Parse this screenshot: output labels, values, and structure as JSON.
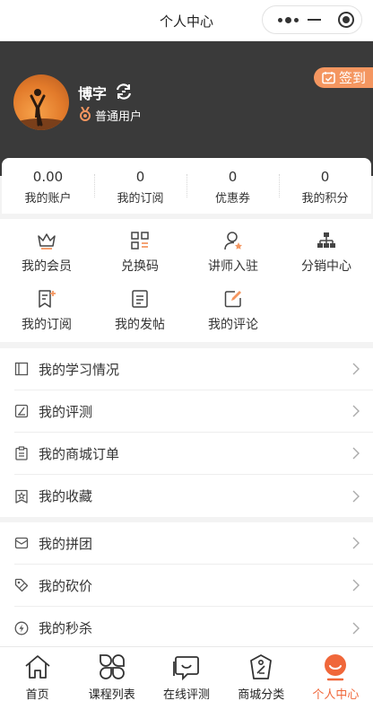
{
  "nav": {
    "title": "个人中心"
  },
  "profile": {
    "name": "博字",
    "user_type": "普通用户",
    "sign_in": "签到"
  },
  "stats": [
    {
      "value": "0.00",
      "label": "我的账户"
    },
    {
      "value": "0",
      "label": "我的订阅"
    },
    {
      "value": "0",
      "label": "优惠券"
    },
    {
      "value": "0",
      "label": "我的积分"
    }
  ],
  "grid": [
    {
      "label": "我的会员",
      "icon": "crown-icon"
    },
    {
      "label": "兑换码",
      "icon": "grid-code-icon"
    },
    {
      "label": "讲师入驻",
      "icon": "lecturer-icon"
    },
    {
      "label": "分销中心",
      "icon": "org-chart-icon"
    },
    {
      "label": "我的订阅",
      "icon": "bookmark-note-icon"
    },
    {
      "label": "我的发帖",
      "icon": "post-doc-icon"
    },
    {
      "label": "我的评论",
      "icon": "edit-icon"
    }
  ],
  "list1": [
    {
      "label": "我的学习情况",
      "icon": "book-icon"
    },
    {
      "label": "我的评测",
      "icon": "quiz-icon"
    },
    {
      "label": "我的商城订单",
      "icon": "order-list-icon"
    },
    {
      "label": "我的收藏",
      "icon": "star-icon"
    }
  ],
  "list2": [
    {
      "label": "我的拼团",
      "icon": "group-mail-icon"
    },
    {
      "label": "我的砍价",
      "icon": "tag-icon"
    },
    {
      "label": "我的秒杀",
      "icon": "flash-icon"
    }
  ],
  "tabs": [
    {
      "label": "首页",
      "icon": "home-icon"
    },
    {
      "label": "课程列表",
      "icon": "course-grid-icon"
    },
    {
      "label": "在线评测",
      "icon": "chat-test-icon"
    },
    {
      "label": "商城分类",
      "icon": "shop-tag-icon"
    },
    {
      "label": "个人中心",
      "icon": "person-icon",
      "active": true
    }
  ],
  "colors": {
    "accent": "#f0673a",
    "header_bg": "#3a3a3a",
    "signin_bg": "#f49660"
  }
}
